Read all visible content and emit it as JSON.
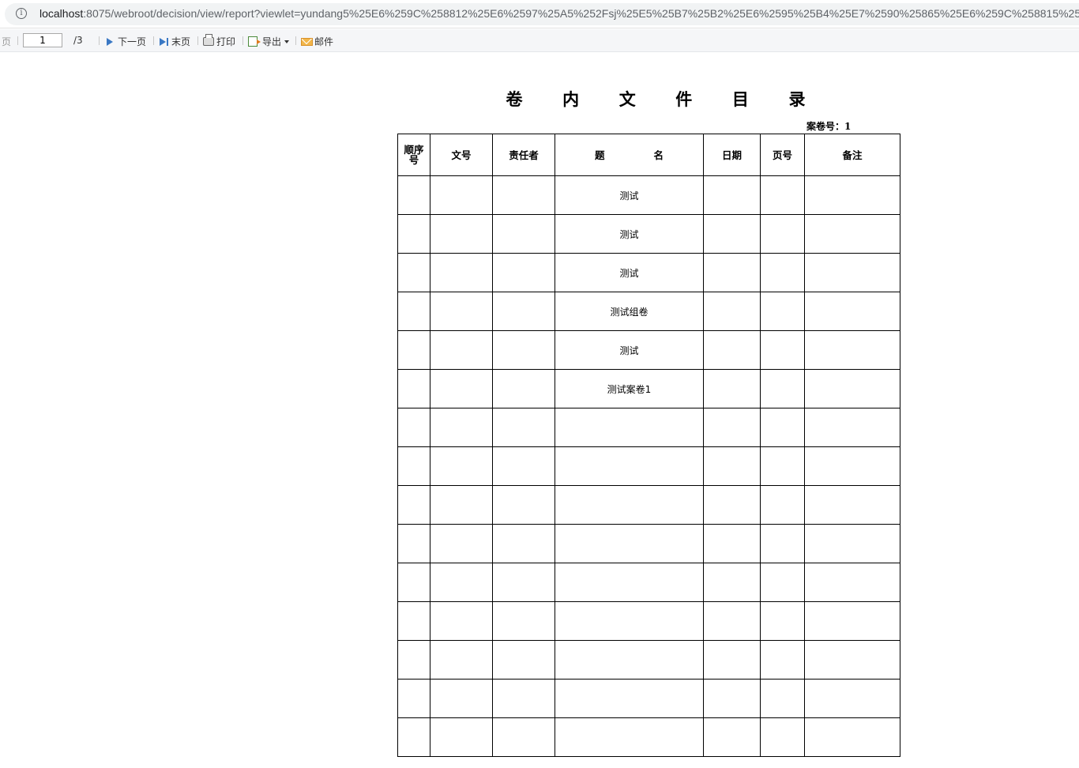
{
  "browser": {
    "url_host": "localhost",
    "url_rest": ":8075/webroot/decision/view/report?viewlet=yundang5%25E6%259C%258812%25E6%2597%25A5%252Fsj%25E5%25B7%25B2%25E6%2595%25B4%25E7%2590%25865%25E6%259C%258815%25E6%259"
  },
  "toolbar": {
    "prev_label_partial": "页",
    "page_input": "1",
    "page_total": "/3",
    "next_label": "下一页",
    "last_label": "末页",
    "print_label": "打印",
    "export_label": "导出",
    "mail_label": "邮件"
  },
  "report": {
    "title_chars": [
      "卷",
      "内",
      "文",
      "件",
      "目",
      "录"
    ],
    "case_number_label": "案卷号：",
    "case_number_value": "1",
    "columns": {
      "seq_line1": "顺序",
      "seq_line2": "号",
      "doc_no": "文号",
      "responsible": "责任者",
      "title_part1": "题",
      "title_part2": "名",
      "date": "日期",
      "page": "页号",
      "remark": "备注"
    },
    "rows": [
      {
        "seq": "",
        "doc_no": "",
        "responsible": "",
        "title": "测试",
        "date": "",
        "page": "",
        "remark": ""
      },
      {
        "seq": "",
        "doc_no": "",
        "responsible": "",
        "title": "测试",
        "date": "",
        "page": "",
        "remark": ""
      },
      {
        "seq": "",
        "doc_no": "",
        "responsible": "",
        "title": "测试",
        "date": "",
        "page": "",
        "remark": ""
      },
      {
        "seq": "",
        "doc_no": "",
        "responsible": "",
        "title": "测试组卷",
        "date": "",
        "page": "",
        "remark": ""
      },
      {
        "seq": "",
        "doc_no": "",
        "responsible": "",
        "title": "测试",
        "date": "",
        "page": "",
        "remark": ""
      },
      {
        "seq": "",
        "doc_no": "",
        "responsible": "",
        "title": "测试案卷1",
        "date": "",
        "page": "",
        "remark": ""
      },
      {
        "seq": "",
        "doc_no": "",
        "responsible": "",
        "title": "",
        "date": "",
        "page": "",
        "remark": ""
      },
      {
        "seq": "",
        "doc_no": "",
        "responsible": "",
        "title": "",
        "date": "",
        "page": "",
        "remark": ""
      },
      {
        "seq": "",
        "doc_no": "",
        "responsible": "",
        "title": "",
        "date": "",
        "page": "",
        "remark": ""
      },
      {
        "seq": "",
        "doc_no": "",
        "responsible": "",
        "title": "",
        "date": "",
        "page": "",
        "remark": ""
      },
      {
        "seq": "",
        "doc_no": "",
        "responsible": "",
        "title": "",
        "date": "",
        "page": "",
        "remark": ""
      },
      {
        "seq": "",
        "doc_no": "",
        "responsible": "",
        "title": "",
        "date": "",
        "page": "",
        "remark": ""
      },
      {
        "seq": "",
        "doc_no": "",
        "responsible": "",
        "title": "",
        "date": "",
        "page": "",
        "remark": ""
      },
      {
        "seq": "",
        "doc_no": "",
        "responsible": "",
        "title": "",
        "date": "",
        "page": "",
        "remark": ""
      },
      {
        "seq": "",
        "doc_no": "",
        "responsible": "",
        "title": "",
        "date": "",
        "page": "",
        "remark": ""
      }
    ]
  }
}
